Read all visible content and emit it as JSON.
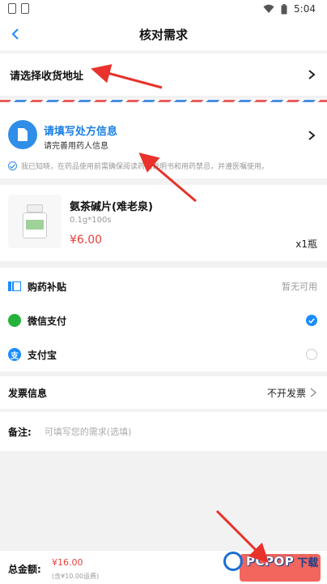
{
  "status_bar": {
    "time": "5:04"
  },
  "nav": {
    "title": "核对需求"
  },
  "address": {
    "label": "请选择收货地址"
  },
  "prescription": {
    "title": "请填写处方信息",
    "subtitle": "请完善用药人信息",
    "notice": "我已知晓，在药品使用前需确保阅读药品说明书和用药禁忌，并遵医嘱使用。"
  },
  "product": {
    "name": "氨茶碱片(难老泉)",
    "spec": "0.1g*100s",
    "price": "¥6.00",
    "qty": "x1瓶"
  },
  "payment": {
    "subsidy_label": "购药补贴",
    "subsidy_value": "暂无可用",
    "wechat_label": "微信支付",
    "wechat_selected": true,
    "alipay_label": "支付宝",
    "alipay_selected": false
  },
  "invoice": {
    "label": "发票信息",
    "value": "不开发票"
  },
  "remark": {
    "label": "备注:",
    "placeholder": "可填写您的需求(选填)"
  },
  "footer": {
    "total_label": "总金额:",
    "total_value": "¥16.00",
    "total_note": "(含¥10.00运费)"
  },
  "watermark": {
    "text": "PCPOP",
    "suffix": "下载"
  },
  "colors": {
    "accent": "#1a8cff",
    "price": "#e8403a",
    "submit": "#f2665e",
    "arrow": "#e8322b"
  }
}
